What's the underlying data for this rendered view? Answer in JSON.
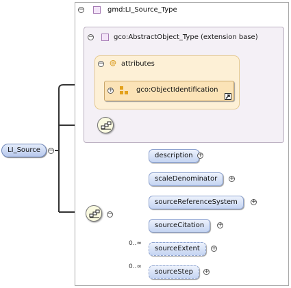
{
  "root": {
    "label": "LI_Source"
  },
  "type_box": {
    "label": "gmd:LI_Source_Type"
  },
  "extension_box": {
    "label": "gco:AbstractObject_Type (extension base)"
  },
  "attributes_box": {
    "label": "attributes",
    "item": {
      "label": "gco:ObjectIdentification"
    }
  },
  "elements": [
    {
      "label": "description",
      "cardinality": ""
    },
    {
      "label": "scaleDenominator",
      "cardinality": ""
    },
    {
      "label": "sourceReferenceSystem",
      "cardinality": ""
    },
    {
      "label": "sourceCitation",
      "cardinality": ""
    },
    {
      "label": "sourceExtent",
      "cardinality": "0..∞"
    },
    {
      "label": "sourceStep",
      "cardinality": "0..∞"
    }
  ]
}
